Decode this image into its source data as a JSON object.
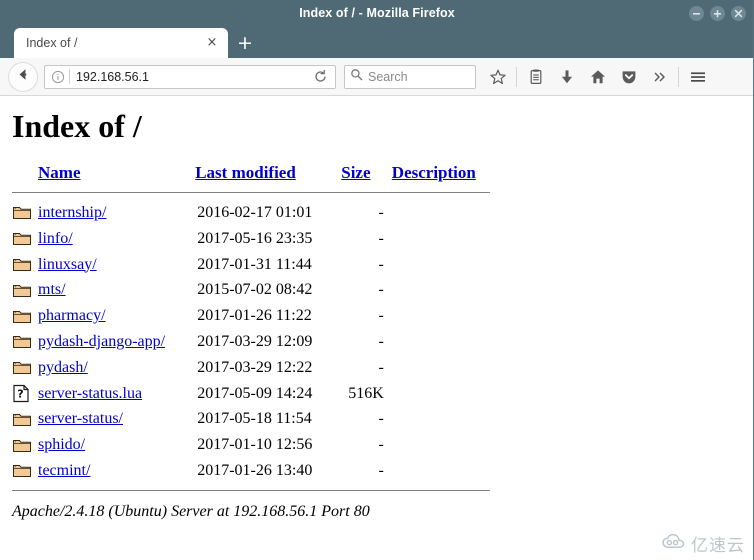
{
  "window": {
    "title": "Index of / - Mozilla Firefox",
    "controls": [
      {
        "name": "minimize-button",
        "glyph": "−"
      },
      {
        "name": "maximize-button",
        "glyph": "+"
      },
      {
        "name": "close-button",
        "glyph": "×"
      }
    ],
    "titlebar_color": "#4f6a75"
  },
  "tabs": {
    "items": [
      {
        "label": "Index of /",
        "close_glyph": "×"
      }
    ],
    "new_tab_glyph": "+"
  },
  "toolbar": {
    "back_icon": "back-arrow-icon",
    "identity_icon": "info-icon",
    "url_value": "192.168.56.1",
    "reload_icon": "reload-icon",
    "search_placeholder": "Search",
    "search_icon": "search-icon",
    "icons": [
      "bookmark-star-icon",
      "library-icon",
      "downloads-icon",
      "home-icon",
      "pocket-icon",
      "overflow-chevrons-icon",
      "hamburger-menu-icon"
    ]
  },
  "page": {
    "heading": "Index of /",
    "columns": {
      "name": "Name",
      "last_modified": "Last modified",
      "size": "Size",
      "description": "Description"
    },
    "entries": [
      {
        "icon": "folder-icon",
        "name": "internship/",
        "last_modified": "2016-02-17 01:01",
        "size": "-",
        "description": ""
      },
      {
        "icon": "folder-icon",
        "name": "linfo/",
        "last_modified": "2017-05-16 23:35",
        "size": "-",
        "description": ""
      },
      {
        "icon": "folder-icon",
        "name": "linuxsay/",
        "last_modified": "2017-01-31 11:44",
        "size": "-",
        "description": ""
      },
      {
        "icon": "folder-icon",
        "name": "mts/",
        "last_modified": "2015-07-02 08:42",
        "size": "-",
        "description": ""
      },
      {
        "icon": "folder-icon",
        "name": "pharmacy/",
        "last_modified": "2017-01-26 11:22",
        "size": "-",
        "description": ""
      },
      {
        "icon": "folder-icon",
        "name": "pydash-django-app/",
        "last_modified": "2017-03-29 12:09",
        "size": "-",
        "description": ""
      },
      {
        "icon": "folder-icon",
        "name": "pydash/",
        "last_modified": "2017-03-29 12:22",
        "size": "-",
        "description": ""
      },
      {
        "icon": "unknown-file-icon",
        "name": "server-status.lua",
        "last_modified": "2017-05-09 14:24",
        "size": "516K",
        "description": ""
      },
      {
        "icon": "folder-icon",
        "name": "server-status/",
        "last_modified": "2017-05-18 11:54",
        "size": "-",
        "description": ""
      },
      {
        "icon": "folder-icon",
        "name": "sphido/",
        "last_modified": "2017-01-10 12:56",
        "size": "-",
        "description": ""
      },
      {
        "icon": "folder-icon",
        "name": "tecmint/",
        "last_modified": "2017-01-26 13:40",
        "size": "-",
        "description": ""
      }
    ],
    "footer": "Apache/2.4.18 (Ubuntu) Server at 192.168.56.1 Port 80",
    "link_color": "#0000cc"
  },
  "watermark": {
    "text": "亿速云",
    "icon": "cloud-icon"
  }
}
